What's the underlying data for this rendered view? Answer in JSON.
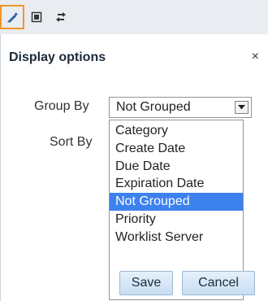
{
  "toolbar": {
    "tools": [
      {
        "icon": "pencil-icon",
        "active": true
      },
      {
        "icon": "panel-icon",
        "active": false
      },
      {
        "icon": "swap-icon",
        "active": false
      }
    ],
    "accent_color": "#f0962a"
  },
  "dialog": {
    "title": "Display options",
    "close_symbol": "×",
    "group_by_label": "Group By",
    "sort_by_label": "Sort By",
    "group_by_selected": "Not Grouped",
    "options": [
      "Category",
      "Create Date",
      "Due Date",
      "Expiration Date",
      "Not Grouped",
      "Priority",
      "Worklist Server"
    ],
    "highlighted_option": "Not Grouped",
    "highlight_color": "#3d81ee",
    "save_label": "Save",
    "cancel_label": "Cancel"
  }
}
